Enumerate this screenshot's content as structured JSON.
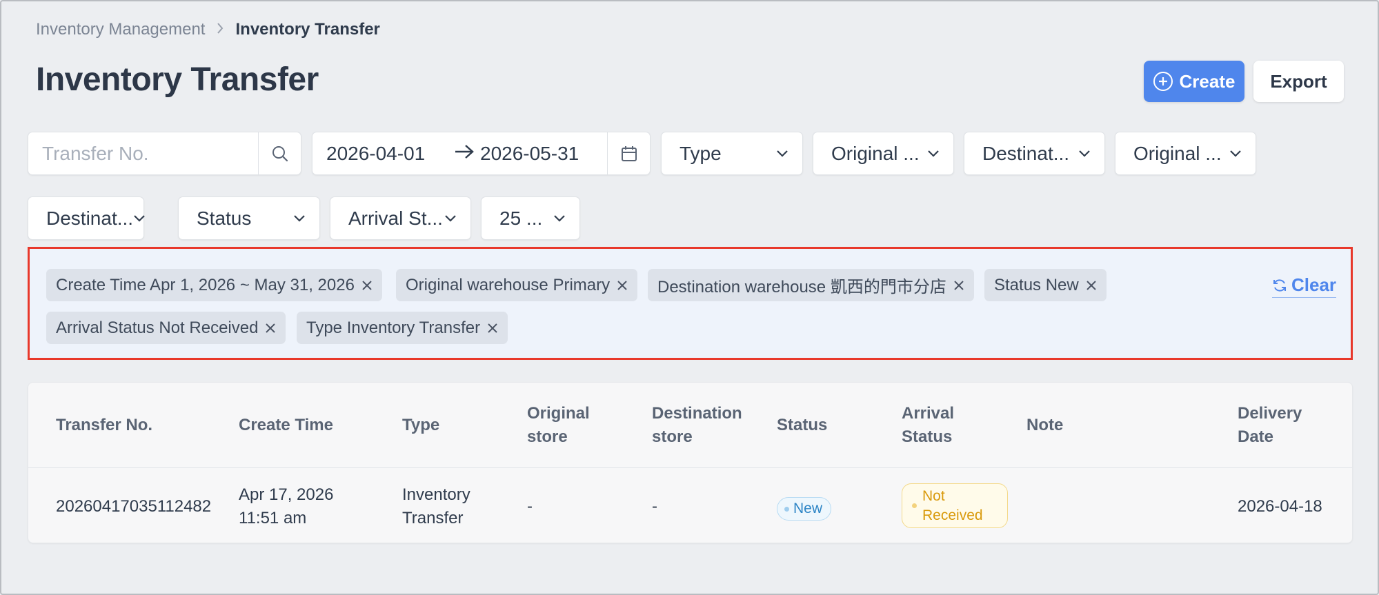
{
  "breadcrumb": {
    "parent": "Inventory Management",
    "current": "Inventory Transfer"
  },
  "page": {
    "title": "Inventory Transfer"
  },
  "actions": {
    "create_label": "Create",
    "export_label": "Export"
  },
  "filters": {
    "search_placeholder": "Transfer No.",
    "date_start": "2026-04-01",
    "date_end": "2026-05-31",
    "dropdowns": [
      "Type",
      "Original ...",
      "Destinat...",
      "Original ...",
      "Destinat...",
      "Status",
      "Arrival St...",
      "25 ..."
    ]
  },
  "active_filters": {
    "tags": [
      "Create Time Apr 1, 2026 ~ May 31, 2026",
      "Original warehouse Primary",
      "Destination warehouse 凱西的門市分店",
      "Status New",
      "Arrival Status Not Received",
      "Type Inventory Transfer"
    ],
    "clear_label": "Clear"
  },
  "table": {
    "headers": [
      "Transfer No.",
      "Create Time",
      "Type",
      "Original store",
      "Destination store",
      "Status",
      "Arrival Status",
      "Note",
      "Delivery Date"
    ],
    "header_lines": {
      "original_1": "Original",
      "original_2": "store",
      "destination_1": "Destination",
      "destination_2": "store",
      "arrival_1": "Arrival",
      "arrival_2": "Status",
      "delivery_1": "Delivery",
      "delivery_2": "Date"
    },
    "rows": [
      {
        "transfer_no": "20260417035112482",
        "create_date": "Apr 17, 2026",
        "create_time": "11:51 am",
        "type_1": "Inventory",
        "type_2": "Transfer",
        "original_store": "-",
        "destination_store": "-",
        "status": "New",
        "arrival_1": "Not",
        "arrival_2": "Received",
        "note": "",
        "delivery_date": "2026-04-18"
      }
    ]
  },
  "colors": {
    "accent": "#4f86ec",
    "highlight_border": "#e8382b",
    "status_new": "#2f86c6",
    "status_not_received": "#d99a0c"
  }
}
